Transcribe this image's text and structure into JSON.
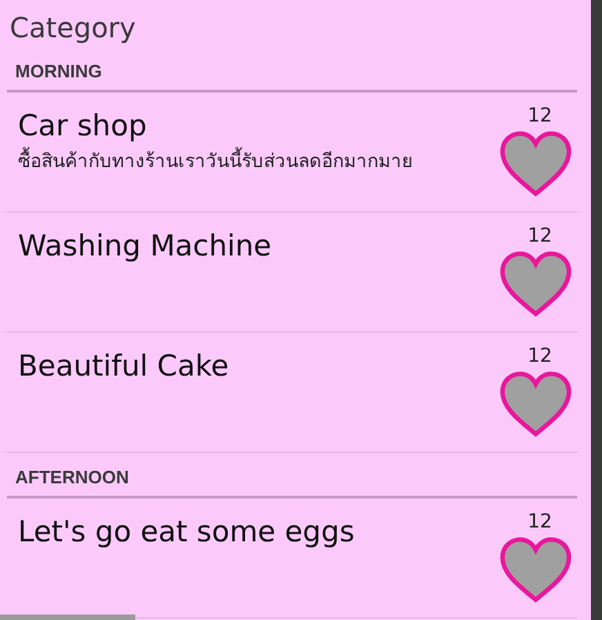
{
  "title": "Category",
  "sections": [
    {
      "header": "MORNING",
      "items": [
        {
          "title": "Car shop",
          "subtitle": "ซื้อสินค้ากับทางร้านเราวันนี้รับส่วนลดอีกมากมาย",
          "count": "12"
        },
        {
          "title": "Washing Machine",
          "count": "12"
        },
        {
          "title": "Beautiful Cake",
          "count": "12"
        }
      ]
    },
    {
      "header": "AFTERNOON",
      "items": [
        {
          "title": "Let's go eat some eggs",
          "count": "12"
        }
      ]
    }
  ]
}
